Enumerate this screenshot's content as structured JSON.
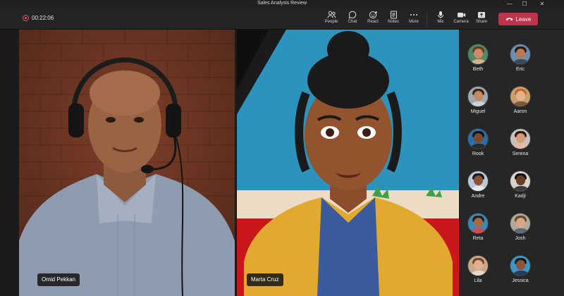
{
  "window": {
    "title": "Sales Analysis Review",
    "controls": {
      "minimize": "—",
      "maximize": "☐",
      "close": "✕"
    }
  },
  "toolbar": {
    "timer": "00:22:06",
    "buttons": [
      {
        "label": "People",
        "icon": "people-icon"
      },
      {
        "label": "Chat",
        "icon": "chat-icon"
      },
      {
        "label": "React",
        "icon": "react-icon"
      },
      {
        "label": "Notes",
        "icon": "notes-icon"
      },
      {
        "label": "More",
        "icon": "more-icon"
      },
      {
        "label": "Mic",
        "icon": "mic-icon"
      },
      {
        "label": "Camera",
        "icon": "camera-icon"
      },
      {
        "label": "Share",
        "icon": "share-icon"
      }
    ],
    "leave_label": "Leave",
    "leave_color": "#c4314b"
  },
  "stage": {
    "tiles": [
      {
        "name": "Omid Pekkan"
      },
      {
        "name": "Marta Cruz"
      }
    ]
  },
  "roster": {
    "people": [
      {
        "name": "Beth"
      },
      {
        "name": "Eric"
      },
      {
        "name": "Miguel"
      },
      {
        "name": "Aaron"
      },
      {
        "name": "Rook"
      },
      {
        "name": "Serena"
      },
      {
        "name": "Andre"
      },
      {
        "name": "Kadji"
      },
      {
        "name": "Reta"
      },
      {
        "name": "Josh"
      },
      {
        "name": "Lila"
      },
      {
        "name": "Jessica"
      }
    ]
  }
}
